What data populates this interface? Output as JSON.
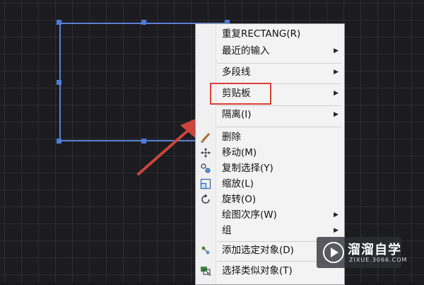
{
  "context_menu": {
    "items": [
      {
        "label": "重复RECTANG(R)",
        "submenu": false,
        "icon": null
      },
      {
        "label": "最近的输入",
        "submenu": true,
        "icon": null
      },
      {
        "label": "多段线",
        "submenu": true,
        "icon": null
      },
      {
        "label": "剪贴板",
        "submenu": true,
        "icon": null,
        "highlighted": true
      },
      {
        "label": "隔离(I)",
        "submenu": true,
        "icon": null
      },
      {
        "label": "删除",
        "submenu": false,
        "icon": "eraser-icon"
      },
      {
        "label": "移动(M)",
        "submenu": false,
        "icon": "move-icon"
      },
      {
        "label": "复制选择(Y)",
        "submenu": false,
        "icon": "copy-selection-icon"
      },
      {
        "label": "缩放(L)",
        "submenu": false,
        "icon": "scale-icon"
      },
      {
        "label": "旋转(O)",
        "submenu": false,
        "icon": "rotate-icon"
      },
      {
        "label": "绘图次序(W)",
        "submenu": true,
        "icon": null
      },
      {
        "label": "组",
        "submenu": true,
        "icon": null
      },
      {
        "label": "添加选定对象(D)",
        "submenu": false,
        "icon": "add-selected-icon"
      },
      {
        "label": "选择类似对象(T)",
        "submenu": false,
        "icon": "select-similar-icon"
      }
    ],
    "submenu_glyph": "▶"
  },
  "watermark": {
    "title": "溜溜自学",
    "subtitle": "ZIXUE.3066.COM"
  },
  "colors": {
    "background": "#1b1b20",
    "grid": "#2c2d33",
    "selection": "#5a82d4",
    "highlight": "#d9403a",
    "arrow": "#c9453a"
  }
}
